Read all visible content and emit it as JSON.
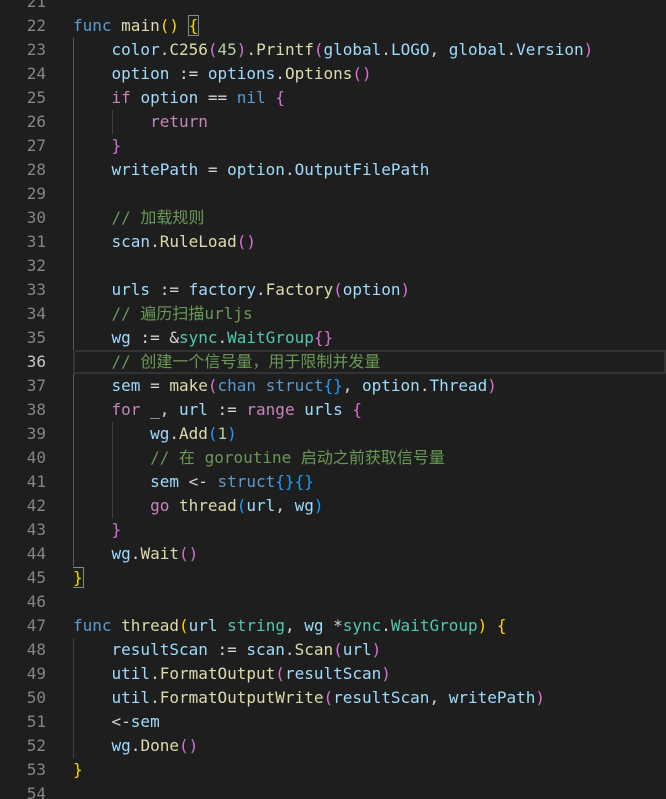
{
  "theme": {
    "background": "#1e1e1e",
    "foreground": "#d4d4d4",
    "line_number": "#858585",
    "active_line_number": "#c6c6c6",
    "indent_guide": "#404040",
    "active_indent_guide": "#5a5a5a",
    "line_highlight_border": "#333333",
    "bracket_match_border": "#888888",
    "bracket_match_background": "#0064001a"
  },
  "editor": {
    "lines": [
      {
        "number": "21",
        "tokens": []
      },
      {
        "number": "22",
        "tokens": [
          [
            "func",
            "#569cd6"
          ],
          [
            " ",
            "#d4d4d4"
          ],
          [
            "main",
            "#dcdcaa"
          ],
          [
            "()",
            "#ffd700"
          ],
          [
            " ",
            "#d4d4d4"
          ],
          [
            "{",
            "#ffd700",
            true
          ]
        ]
      },
      {
        "number": "23",
        "tokens": [
          [
            "    ",
            "#d4d4d4"
          ],
          [
            "color",
            "#9cdcfe"
          ],
          [
            ".",
            "#d4d4d4"
          ],
          [
            "C256",
            "#dcdcaa"
          ],
          [
            "(",
            "#da70d6"
          ],
          [
            "45",
            "#b5cea8"
          ],
          [
            ")",
            "#da70d6"
          ],
          [
            ".",
            "#d4d4d4"
          ],
          [
            "Printf",
            "#dcdcaa"
          ],
          [
            "(",
            "#da70d6"
          ],
          [
            "global",
            "#9cdcfe"
          ],
          [
            ".",
            "#d4d4d4"
          ],
          [
            "LOGO",
            "#9cdcfe"
          ],
          [
            ", ",
            "#d4d4d4"
          ],
          [
            "global",
            "#9cdcfe"
          ],
          [
            ".",
            "#d4d4d4"
          ],
          [
            "Version",
            "#9cdcfe"
          ],
          [
            ")",
            "#da70d6"
          ]
        ]
      },
      {
        "number": "24",
        "tokens": [
          [
            "    ",
            "#d4d4d4"
          ],
          [
            "option",
            "#9cdcfe"
          ],
          [
            " := ",
            "#d4d4d4"
          ],
          [
            "options",
            "#9cdcfe"
          ],
          [
            ".",
            "#d4d4d4"
          ],
          [
            "Options",
            "#dcdcaa"
          ],
          [
            "()",
            "#da70d6"
          ]
        ]
      },
      {
        "number": "25",
        "tokens": [
          [
            "    ",
            "#d4d4d4"
          ],
          [
            "if",
            "#c586c0"
          ],
          [
            " ",
            "#d4d4d4"
          ],
          [
            "option",
            "#9cdcfe"
          ],
          [
            " == ",
            "#d4d4d4"
          ],
          [
            "nil",
            "#569cd6"
          ],
          [
            " ",
            "#d4d4d4"
          ],
          [
            "{",
            "#da70d6"
          ]
        ]
      },
      {
        "number": "26",
        "tokens": [
          [
            "        ",
            "#d4d4d4"
          ],
          [
            "return",
            "#c586c0"
          ]
        ]
      },
      {
        "number": "27",
        "tokens": [
          [
            "    ",
            "#d4d4d4"
          ],
          [
            "}",
            "#da70d6"
          ]
        ]
      },
      {
        "number": "28",
        "tokens": [
          [
            "    ",
            "#d4d4d4"
          ],
          [
            "writePath",
            "#9cdcfe"
          ],
          [
            " = ",
            "#d4d4d4"
          ],
          [
            "option",
            "#9cdcfe"
          ],
          [
            ".",
            "#d4d4d4"
          ],
          [
            "OutputFilePath",
            "#9cdcfe"
          ]
        ]
      },
      {
        "number": "29",
        "tokens": []
      },
      {
        "number": "30",
        "tokens": [
          [
            "    ",
            "#d4d4d4"
          ],
          [
            "// 加载规则",
            "#6a9955"
          ]
        ]
      },
      {
        "number": "31",
        "tokens": [
          [
            "    ",
            "#d4d4d4"
          ],
          [
            "scan",
            "#9cdcfe"
          ],
          [
            ".",
            "#d4d4d4"
          ],
          [
            "RuleLoad",
            "#dcdcaa"
          ],
          [
            "()",
            "#da70d6"
          ]
        ]
      },
      {
        "number": "32",
        "tokens": []
      },
      {
        "number": "33",
        "tokens": [
          [
            "    ",
            "#d4d4d4"
          ],
          [
            "urls",
            "#9cdcfe"
          ],
          [
            " := ",
            "#d4d4d4"
          ],
          [
            "factory",
            "#9cdcfe"
          ],
          [
            ".",
            "#d4d4d4"
          ],
          [
            "Factory",
            "#dcdcaa"
          ],
          [
            "(",
            "#da70d6"
          ],
          [
            "option",
            "#9cdcfe"
          ],
          [
            ")",
            "#da70d6"
          ]
        ]
      },
      {
        "number": "34",
        "tokens": [
          [
            "    ",
            "#d4d4d4"
          ],
          [
            "// 遍历扫描urljs",
            "#6a9955"
          ]
        ]
      },
      {
        "number": "35",
        "tokens": [
          [
            "    ",
            "#d4d4d4"
          ],
          [
            "wg",
            "#9cdcfe"
          ],
          [
            " := &",
            "#d4d4d4"
          ],
          [
            "sync",
            "#4ec9b0"
          ],
          [
            ".",
            "#d4d4d4"
          ],
          [
            "WaitGroup",
            "#4ec9b0"
          ],
          [
            "{}",
            "#da70d6"
          ]
        ]
      },
      {
        "number": "36",
        "active": true,
        "tokens": [
          [
            "    ",
            "#d4d4d4"
          ],
          [
            "// 创建一个信号量，用于限制并发量",
            "#6a9955"
          ]
        ]
      },
      {
        "number": "37",
        "tokens": [
          [
            "    ",
            "#d4d4d4"
          ],
          [
            "sem",
            "#9cdcfe"
          ],
          [
            " = ",
            "#d4d4d4"
          ],
          [
            "make",
            "#dcdcaa"
          ],
          [
            "(",
            "#da70d6"
          ],
          [
            "chan",
            "#569cd6"
          ],
          [
            " ",
            "#d4d4d4"
          ],
          [
            "struct",
            "#569cd6"
          ],
          [
            "{}",
            "#179fff"
          ],
          [
            ", ",
            "#d4d4d4"
          ],
          [
            "option",
            "#9cdcfe"
          ],
          [
            ".",
            "#d4d4d4"
          ],
          [
            "Thread",
            "#9cdcfe"
          ],
          [
            ")",
            "#da70d6"
          ]
        ]
      },
      {
        "number": "38",
        "tokens": [
          [
            "    ",
            "#d4d4d4"
          ],
          [
            "for",
            "#c586c0"
          ],
          [
            " _, ",
            "#d4d4d4"
          ],
          [
            "url",
            "#9cdcfe"
          ],
          [
            " := ",
            "#d4d4d4"
          ],
          [
            "range",
            "#c586c0"
          ],
          [
            " ",
            "#d4d4d4"
          ],
          [
            "urls",
            "#9cdcfe"
          ],
          [
            " ",
            "#d4d4d4"
          ],
          [
            "{",
            "#da70d6"
          ]
        ]
      },
      {
        "number": "39",
        "tokens": [
          [
            "        ",
            "#d4d4d4"
          ],
          [
            "wg",
            "#9cdcfe"
          ],
          [
            ".",
            "#d4d4d4"
          ],
          [
            "Add",
            "#dcdcaa"
          ],
          [
            "(",
            "#179fff"
          ],
          [
            "1",
            "#b5cea8"
          ],
          [
            ")",
            "#179fff"
          ]
        ]
      },
      {
        "number": "40",
        "tokens": [
          [
            "        ",
            "#d4d4d4"
          ],
          [
            "// 在 goroutine 启动之前获取信号量",
            "#6a9955"
          ]
        ]
      },
      {
        "number": "41",
        "tokens": [
          [
            "        ",
            "#d4d4d4"
          ],
          [
            "sem",
            "#9cdcfe"
          ],
          [
            " <- ",
            "#d4d4d4"
          ],
          [
            "struct",
            "#569cd6"
          ],
          [
            "{}{}",
            "#179fff"
          ]
        ]
      },
      {
        "number": "42",
        "tokens": [
          [
            "        ",
            "#d4d4d4"
          ],
          [
            "go",
            "#c586c0"
          ],
          [
            " ",
            "#d4d4d4"
          ],
          [
            "thread",
            "#dcdcaa"
          ],
          [
            "(",
            "#179fff"
          ],
          [
            "url",
            "#9cdcfe"
          ],
          [
            ", ",
            "#d4d4d4"
          ],
          [
            "wg",
            "#9cdcfe"
          ],
          [
            ")",
            "#179fff"
          ]
        ]
      },
      {
        "number": "43",
        "tokens": [
          [
            "    ",
            "#d4d4d4"
          ],
          [
            "}",
            "#da70d6"
          ]
        ]
      },
      {
        "number": "44",
        "tokens": [
          [
            "    ",
            "#d4d4d4"
          ],
          [
            "wg",
            "#9cdcfe"
          ],
          [
            ".",
            "#d4d4d4"
          ],
          [
            "Wait",
            "#dcdcaa"
          ],
          [
            "()",
            "#da70d6"
          ]
        ]
      },
      {
        "number": "45",
        "tokens": [
          [
            "}",
            "#ffd700",
            true
          ]
        ]
      },
      {
        "number": "46",
        "tokens": []
      },
      {
        "number": "47",
        "tokens": [
          [
            "func",
            "#569cd6"
          ],
          [
            " ",
            "#d4d4d4"
          ],
          [
            "thread",
            "#dcdcaa"
          ],
          [
            "(",
            "#ffd700"
          ],
          [
            "url",
            "#9cdcfe"
          ],
          [
            " ",
            "#d4d4d4"
          ],
          [
            "string",
            "#4ec9b0"
          ],
          [
            ", ",
            "#d4d4d4"
          ],
          [
            "wg",
            "#9cdcfe"
          ],
          [
            " *",
            "#d4d4d4"
          ],
          [
            "sync",
            "#4ec9b0"
          ],
          [
            ".",
            "#d4d4d4"
          ],
          [
            "WaitGroup",
            "#4ec9b0"
          ],
          [
            ")",
            "#ffd700"
          ],
          [
            " ",
            "#d4d4d4"
          ],
          [
            "{",
            "#ffd700"
          ]
        ]
      },
      {
        "number": "48",
        "tokens": [
          [
            "    ",
            "#d4d4d4"
          ],
          [
            "resultScan",
            "#9cdcfe"
          ],
          [
            " := ",
            "#d4d4d4"
          ],
          [
            "scan",
            "#9cdcfe"
          ],
          [
            ".",
            "#d4d4d4"
          ],
          [
            "Scan",
            "#dcdcaa"
          ],
          [
            "(",
            "#da70d6"
          ],
          [
            "url",
            "#9cdcfe"
          ],
          [
            ")",
            "#da70d6"
          ]
        ]
      },
      {
        "number": "49",
        "tokens": [
          [
            "    ",
            "#d4d4d4"
          ],
          [
            "util",
            "#9cdcfe"
          ],
          [
            ".",
            "#d4d4d4"
          ],
          [
            "FormatOutput",
            "#dcdcaa"
          ],
          [
            "(",
            "#da70d6"
          ],
          [
            "resultScan",
            "#9cdcfe"
          ],
          [
            ")",
            "#da70d6"
          ]
        ]
      },
      {
        "number": "50",
        "tokens": [
          [
            "    ",
            "#d4d4d4"
          ],
          [
            "util",
            "#9cdcfe"
          ],
          [
            ".",
            "#d4d4d4"
          ],
          [
            "FormatOutputWrite",
            "#dcdcaa"
          ],
          [
            "(",
            "#da70d6"
          ],
          [
            "resultScan",
            "#9cdcfe"
          ],
          [
            ", ",
            "#d4d4d4"
          ],
          [
            "writePath",
            "#9cdcfe"
          ],
          [
            ")",
            "#da70d6"
          ]
        ]
      },
      {
        "number": "51",
        "tokens": [
          [
            "    ",
            "#d4d4d4"
          ],
          [
            "<-",
            "#d4d4d4"
          ],
          [
            "sem",
            "#9cdcfe"
          ]
        ]
      },
      {
        "number": "52",
        "tokens": [
          [
            "    ",
            "#d4d4d4"
          ],
          [
            "wg",
            "#9cdcfe"
          ],
          [
            ".",
            "#d4d4d4"
          ],
          [
            "Done",
            "#dcdcaa"
          ],
          [
            "()",
            "#da70d6"
          ]
        ]
      },
      {
        "number": "53",
        "tokens": [
          [
            "}",
            "#ffd700"
          ]
        ]
      },
      {
        "number": "54",
        "tokens": []
      }
    ]
  }
}
